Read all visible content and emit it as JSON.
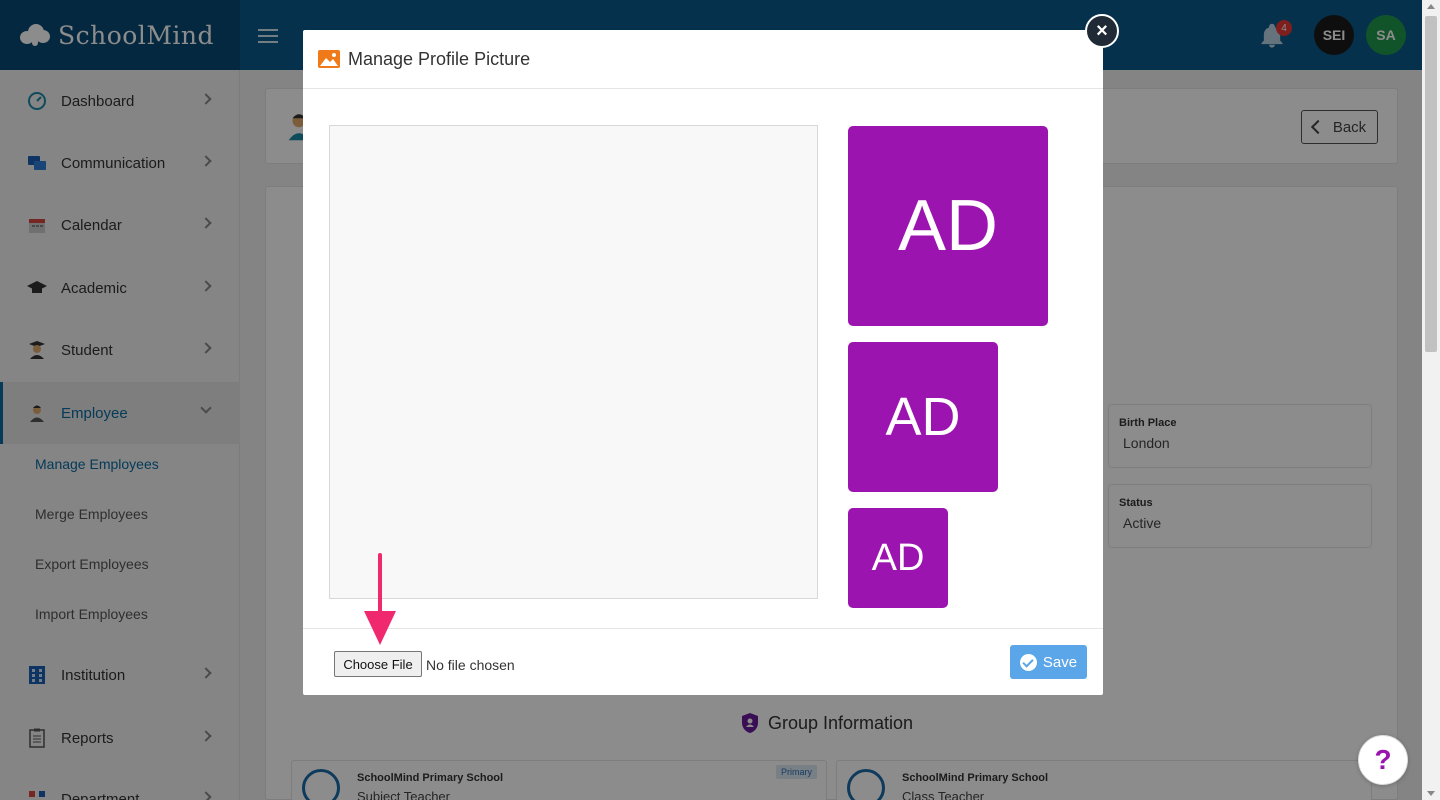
{
  "brand": {
    "name": "SchoolMind"
  },
  "header": {
    "notification_count": "4",
    "avatar_sei": "SEI",
    "avatar_sa": "SA"
  },
  "sidebar": {
    "items": [
      {
        "label": "Dashboard"
      },
      {
        "label": "Communication"
      },
      {
        "label": "Calendar"
      },
      {
        "label": "Academic"
      },
      {
        "label": "Student"
      },
      {
        "label": "Employee"
      },
      {
        "label": "Institution"
      },
      {
        "label": "Reports"
      },
      {
        "label": "Department"
      }
    ],
    "sub_items": [
      {
        "label": "Manage Employees"
      },
      {
        "label": "Merge Employees"
      },
      {
        "label": "Export Employees"
      },
      {
        "label": "Import Employees"
      }
    ]
  },
  "page": {
    "back_label": "Back",
    "fields": [
      {
        "label": "Birth Place",
        "value": "London"
      },
      {
        "label": "Status",
        "value": "Active"
      }
    ],
    "group_title": "Group Information",
    "schools": [
      {
        "name": "SchoolMind Primary School",
        "role": "Subject Teacher",
        "tag": "Primary"
      },
      {
        "name": "SchoolMind Primary School",
        "role": "Class Teacher"
      }
    ]
  },
  "modal": {
    "title": "Manage Profile Picture",
    "close_symbol": "×",
    "initials": "AD",
    "choose_file_label": "Choose File",
    "file_status": "No file chosen",
    "save_label": "Save"
  },
  "help": {
    "symbol": "?"
  },
  "colors": {
    "header": "#0a5a8a",
    "brand": "#074a74",
    "accent": "#0a6aa1",
    "avatar_purple": "#9c14b0",
    "save": "#5aa6e8",
    "arrow": "#f0286e"
  }
}
